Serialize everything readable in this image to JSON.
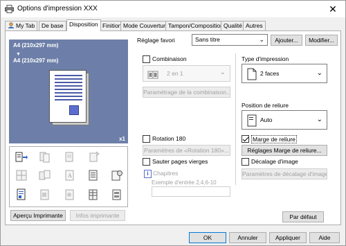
{
  "window": {
    "title": "Options d'impression XXX",
    "close_glyph": "✕"
  },
  "tabs": [
    {
      "label": "My Tab",
      "icon": "person-icon"
    },
    {
      "label": "De base"
    },
    {
      "label": "Disposition",
      "active": true
    },
    {
      "label": "Finition"
    },
    {
      "label": "Mode Couverture"
    },
    {
      "label": "Tampon/Composition"
    },
    {
      "label": "Qualité"
    },
    {
      "label": "Autres"
    }
  ],
  "preview": {
    "size_top": "A4 (210x297 mm)",
    "arrow": "▼",
    "size_bottom": "A4 (210x297 mm)",
    "count": "x1"
  },
  "favorite": {
    "label": "Réglage favori",
    "value": "Sans titre",
    "add_button": "Ajouter...",
    "modify_button": "Modifier..."
  },
  "combinaison": {
    "label": "Combinaison",
    "checked": false,
    "select_value": "2 en 1",
    "settings_button": "Paramétrage de la combinaison..."
  },
  "type_impression": {
    "label": "Type d'impression",
    "value": "2 faces"
  },
  "position_reliure": {
    "label": "Position de reliure",
    "value": "Auto"
  },
  "rotation": {
    "label": "Rotation 180",
    "checked": false,
    "settings_button": "Paramètres de «Rotation 180»..."
  },
  "marge_reliure": {
    "label": "Marge de reliure",
    "checked": true,
    "settings_button": "Réglages Marge de reliure..."
  },
  "sauter_pages": {
    "label": "Sauter pages vierges",
    "checked": false
  },
  "decalage_image": {
    "label": "Décalage d'image",
    "checked": false,
    "settings_button": "Paramètres de décalage d'image..."
  },
  "chapitres": {
    "label": "Chapitres",
    "example": "Exemple d'entrée 2,4,6-10",
    "value": ""
  },
  "bottom_left": {
    "preview_button": "Aperçu Imprimante",
    "info_button": "Infos imprimante"
  },
  "default_button": "Par défaut",
  "dialog_buttons": {
    "ok": "OK",
    "cancel": "Annuler",
    "apply": "Appliquer",
    "help": "Aide"
  },
  "colors": {
    "accent": "#0078d7",
    "preview_bg": "#6d7fa8",
    "page_lines": "#4a5aa8",
    "disabled_text": "#a0a0a0"
  }
}
